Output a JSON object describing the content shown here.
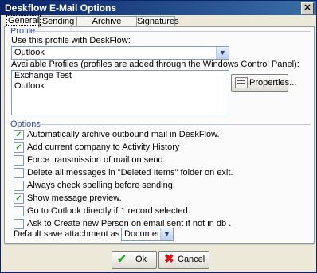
{
  "window": {
    "title": "Deskflow E-Mail Options"
  },
  "tabs": [
    {
      "label": "General",
      "active": true
    },
    {
      "label": "Sending",
      "active": false
    },
    {
      "label": "Archive Exception",
      "active": false
    },
    {
      "label": "Signatures",
      "active": false
    }
  ],
  "profile": {
    "group_label": "Profile",
    "use_profile_label": "Use this profile with DeskFlow:",
    "selected_profile": "Outlook",
    "available_label": "Available Profiles (profiles are added through the Windows Control Panel):",
    "available_profiles": [
      "Exchange Test",
      "Outlook"
    ],
    "properties_button": "Properties..."
  },
  "options": {
    "group_label": "Options",
    "checkboxes": [
      {
        "label": "Automatically archive outbound mail in DeskFlow.",
        "checked": true
      },
      {
        "label": "Add current company to Activity History",
        "checked": true
      },
      {
        "label": "Force transmission of mail on send.",
        "checked": false
      },
      {
        "label": "Delete all messages in \"Deleted Items\" folder on exit.",
        "checked": false
      },
      {
        "label": "Always check spelling before sending.",
        "checked": false
      },
      {
        "label": "Show message preview.",
        "checked": true
      },
      {
        "label": "Go to Outlook directly if 1 record selected.",
        "checked": false
      },
      {
        "label": "Ask to Create new Person on email sent if not in db .",
        "checked": false
      }
    ],
    "default_save_label": "Default save attachment as",
    "default_save_value": "Document"
  },
  "buttons": {
    "ok": "Ok",
    "cancel": "Cancel"
  },
  "icons": {
    "close": "close-icon",
    "checkmark": "checkmark-icon",
    "ok": "checkmark-icon",
    "cancel": "x-icon",
    "properties": "properties-icon",
    "dropdown": "chevron-down-icon"
  },
  "colors": {
    "title_bar": "#0a246a",
    "group_label": "#2f4bb2",
    "ok_icon": "#21a121",
    "cancel_icon": "#dd1111"
  }
}
